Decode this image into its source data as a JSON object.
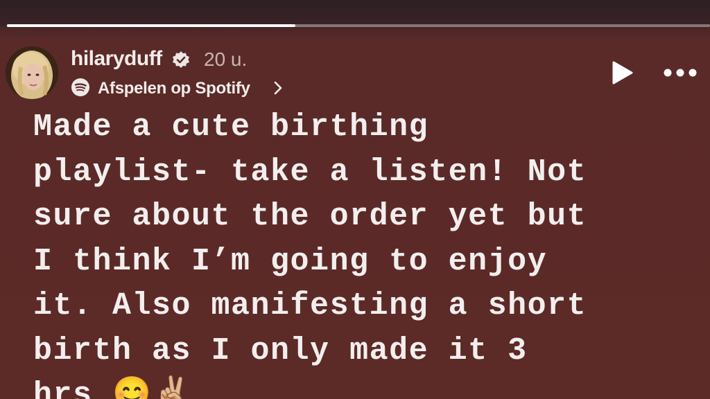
{
  "story": {
    "progress_fraction": 0.41,
    "user": {
      "username": "hilaryduff",
      "verified": true,
      "time_ago": "20 u."
    },
    "music": {
      "label": "Afspelen op Spotify",
      "icon": "spotify-icon"
    },
    "controls": {
      "play_icon": "play-icon",
      "more_icon": "more-options-icon"
    },
    "text_lines": [
      "Made a cute birthing",
      "playlist- take a listen! Not",
      "sure about the order yet but",
      "I think I’m going to enjoy",
      "it. Also manifesting a short",
      "birth as I only made it 3",
      "hrs 😊✌🏼"
    ]
  },
  "colors": {
    "background": "#5c2a27",
    "text": "#f3eeee",
    "muted": "#c9b6b4"
  }
}
